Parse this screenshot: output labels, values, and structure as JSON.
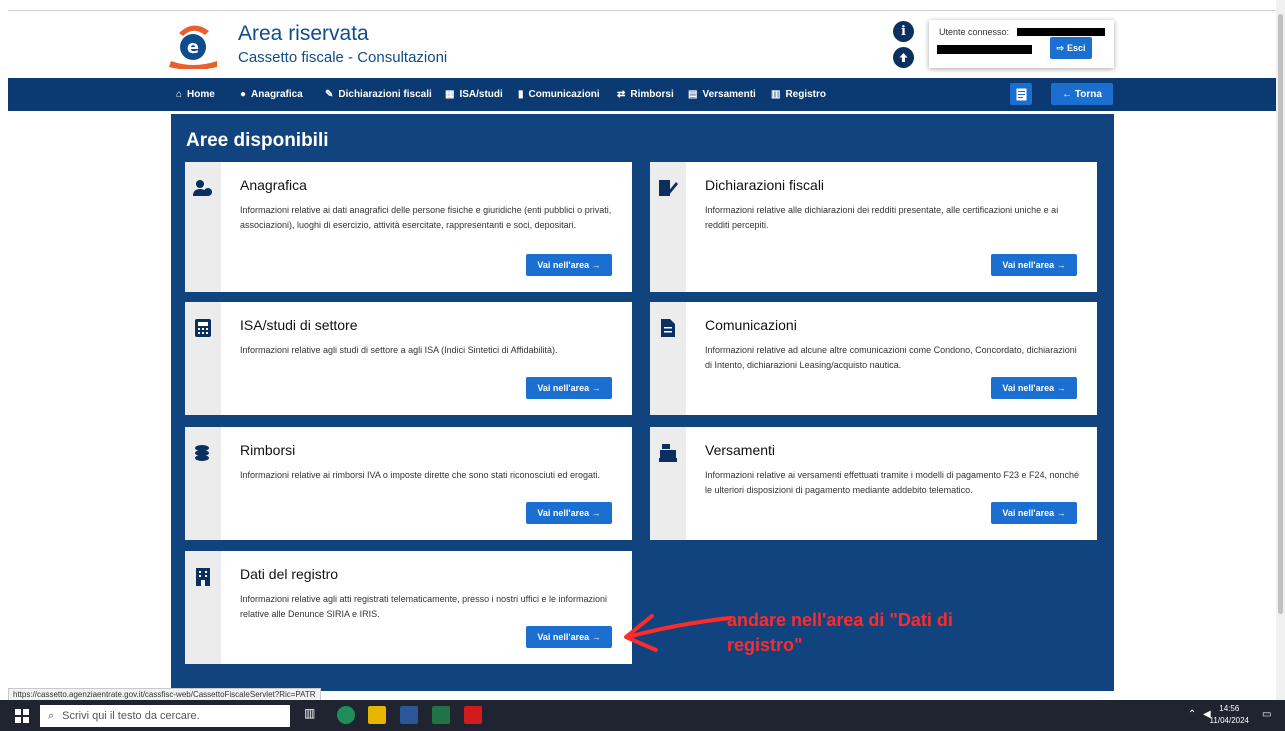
{
  "header": {
    "title": "Area riservata",
    "subtitle": "Cassetto fiscale - Consultazioni",
    "info_icon": "i",
    "user_label": "Utente connesso:",
    "logout_label": "Esci"
  },
  "nav": {
    "items": [
      {
        "label": "Home",
        "icon": "home-icon"
      },
      {
        "label": "Anagrafica",
        "icon": "users-icon"
      },
      {
        "label": "Dichiarazioni fiscali",
        "icon": "document-edit-icon"
      },
      {
        "label": "ISA/studi",
        "icon": "calculator-icon"
      },
      {
        "label": "Comunicazioni",
        "icon": "file-icon"
      },
      {
        "label": "Rimborsi",
        "icon": "refund-icon"
      },
      {
        "label": "Versamenti",
        "icon": "payment-icon"
      },
      {
        "label": "Registro",
        "icon": "building-icon"
      }
    ],
    "back_label": "← Torna"
  },
  "main": {
    "title": "Aree disponibili",
    "cards": [
      {
        "title": "Anagrafica",
        "text": "Informazioni relative ai dati anagrafici delle persone fisiche e giuridiche (enti pubblici o privati, associazioni), luoghi di esercizio, attività esercitate, rappresentanti e soci, depositari.",
        "button": "Vai nell'area  →",
        "icon": "users-icon"
      },
      {
        "title": "Dichiarazioni fiscali",
        "text": "Informazioni relative alle dichiarazioni dei redditi presentate, alle certificazioni uniche e ai redditi percepiti.",
        "button": "Vai nell'area  →",
        "icon": "document-edit-icon"
      },
      {
        "title": "ISA/studi di settore",
        "text": "Informazioni relative agli studi di settore a agli ISA (Indici Sintetici di Affidabilità).",
        "button": "Vai nell'area  →",
        "icon": "calculator-icon"
      },
      {
        "title": "Comunicazioni",
        "text": "Informazioni relative ad alcune altre comunicazioni come Condono, Concordato, dichiarazioni di Intento, dichiarazioni Leasing/acquisto nautica.",
        "button": "Vai nell'area  →",
        "icon": "file-icon"
      },
      {
        "title": "Rimborsi",
        "text": "Informazioni relative ai rimborsi IVA o imposte dirette che sono stati riconosciuti ed erogati.",
        "button": "Vai nell'area  →",
        "icon": "coins-icon"
      },
      {
        "title": "Versamenti",
        "text": "Informazioni relative ai versamenti effettuati tramite i modelli di pagamento F23 e F24, nonché le ulteriori disposizioni di pagamento mediante addebito telematico.",
        "button": "Vai nell'area  →",
        "icon": "cash-register-icon"
      },
      {
        "title": "Dati del registro",
        "text": "Informazioni relative agli atti registrati telematicamente, presso i nostri uffici e le informazioni relative alle Denunce SIRIA e IRIS.",
        "button": "Vai nell'area  →",
        "icon": "building-icon"
      }
    ]
  },
  "annotation": {
    "text": "andare nell'area di \"Dati di registro\"",
    "color": "#ff2a2a"
  },
  "status_url": "https://cassetto.agenziaentrate.gov.it/cassfisc-web/CassettoFiscaleServlet?Ric=PATR",
  "taskbar": {
    "search_placeholder": "Scrivi qui il testo da cercare.",
    "time": "14:56",
    "date": "11/04/2024"
  },
  "colors": {
    "brand_dark": "#0b3a73",
    "panel": "#11437f",
    "button": "#1a6fd1"
  }
}
